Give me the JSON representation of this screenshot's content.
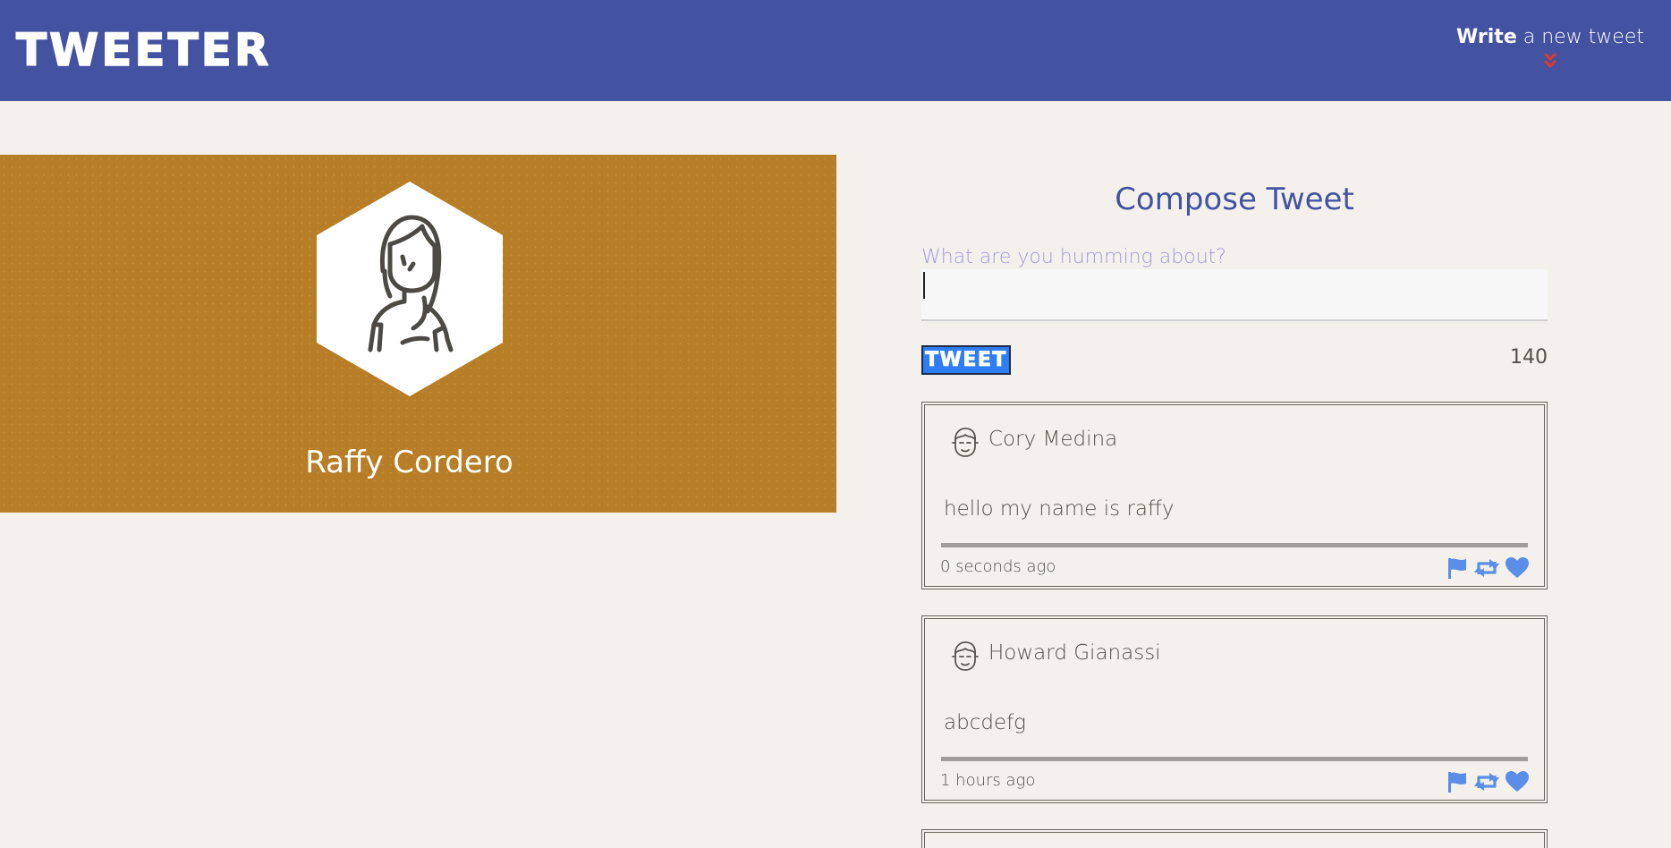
{
  "nav": {
    "logo": "TWEETER",
    "write_strong": "Write",
    "write_rest": " a new tweet",
    "toggle_icon": "double-chevron-down-icon",
    "accent_color": "#e03a2e"
  },
  "profile": {
    "name": "Raffy Cordero",
    "avatar_icon": "woman-avatar-icon",
    "background_color": "#b77d27"
  },
  "compose": {
    "title": "Compose Tweet",
    "placeholder": "What are you humming about?",
    "input_value": "",
    "button_label": "TWEET",
    "counter": "140"
  },
  "tweets": [
    {
      "author": "Cory Medina",
      "text": "hello my name is raffy",
      "time": "0 seconds ago",
      "avatar_icon": "man-avatar-icon",
      "actions": [
        "flag-icon",
        "retweet-icon",
        "heart-icon"
      ]
    },
    {
      "author": "Howard Gianassi",
      "text": "abcdefg",
      "time": "1 hours ago",
      "avatar_icon": "man-avatar-icon",
      "actions": [
        "flag-icon",
        "retweet-icon",
        "heart-icon"
      ]
    }
  ],
  "colors": {
    "nav": "#4352a1",
    "action_icons": "#5b8ee8",
    "tweet_button": "#2f7df5"
  }
}
